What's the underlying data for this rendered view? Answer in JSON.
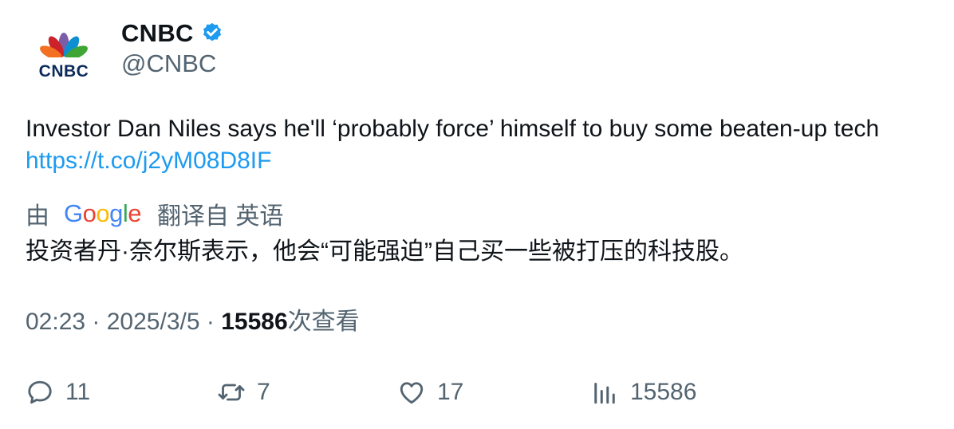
{
  "author": {
    "display_name": "CNBC",
    "handle": "@CNBC",
    "verified": true,
    "avatar_logo_text": "CNBC",
    "avatar_icon": "peacock-logo"
  },
  "tweet": {
    "text": "Investor Dan Niles says he'll ‘probably force’ himself to buy some beaten-up tech ",
    "link": "https://t.co/j2yM08D8IF"
  },
  "translation": {
    "prefix": "由",
    "provider_letters": [
      "G",
      "o",
      "o",
      "g",
      "l",
      "e"
    ],
    "suffix": "翻译自 英语",
    "text": "投资者丹·奈尔斯表示，他会“可能强迫”自己买一些被打压的科技股。"
  },
  "meta": {
    "time": "02:23",
    "separator": " · ",
    "date": "2025/3/5",
    "views_count": "15586",
    "views_label": "次查看"
  },
  "actions": {
    "replies": "11",
    "retweets": "7",
    "likes": "17",
    "views": "15586"
  },
  "colors": {
    "link": "#1d9bf0",
    "secondary_text": "#536471",
    "primary_text": "#0f1419",
    "verified_badge": "#1d9bf0"
  }
}
